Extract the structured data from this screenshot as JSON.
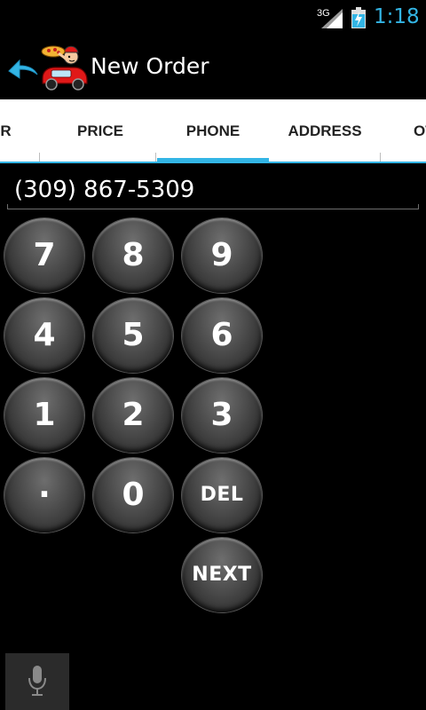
{
  "status_bar": {
    "network": "3G",
    "time": "1:18"
  },
  "action_bar": {
    "title": "New Order"
  },
  "tabs": [
    {
      "label": "ORDER"
    },
    {
      "label": "PRICE"
    },
    {
      "label": "PHONE",
      "selected": true
    },
    {
      "label": "ADDRESS"
    },
    {
      "label": "OTHER"
    }
  ],
  "phone_field": {
    "value": "(309) 867-5309"
  },
  "keypad": {
    "k7": "7",
    "k8": "8",
    "k9": "9",
    "k4": "4",
    "k5": "5",
    "k6": "6",
    "k1": "1",
    "k2": "2",
    "k3": "3",
    "dot": "·",
    "k0": "0",
    "del": "DEL",
    "next": "NEXT"
  },
  "icons": {
    "back": "back-arrow-icon",
    "logo": "pizza-delivery-logo-icon",
    "mic": "microphone-icon",
    "signal": "signal-icon",
    "battery": "battery-charging-icon"
  },
  "colors": {
    "accent": "#33b5e5",
    "background": "#000000",
    "tab_background": "#ffffff"
  }
}
